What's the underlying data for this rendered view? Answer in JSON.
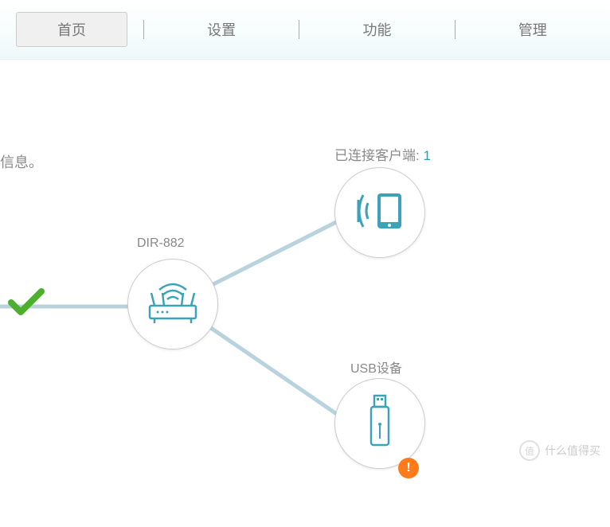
{
  "nav": {
    "home": "首页",
    "settings": "设置",
    "features": "功能",
    "management": "管理"
  },
  "content": {
    "partial_title_fragment": "　",
    "info_fragment": "信息。",
    "router_label": "DIR-882",
    "clients_label": "已连接客户端: ",
    "clients_count": "1",
    "usb_label": "USB设备"
  },
  "watermark": {
    "badge": "值",
    "text": "什么值得买"
  },
  "icons": {
    "router": "router-icon",
    "clients": "wireless-client-icon",
    "usb": "usb-drive-icon",
    "check": "checkmark-icon",
    "alert": "alert-icon"
  },
  "colors": {
    "accent": "#3aa3b8",
    "line": "#b8d3de",
    "check": "#4caf2e",
    "alert": "#ff7a1a"
  }
}
